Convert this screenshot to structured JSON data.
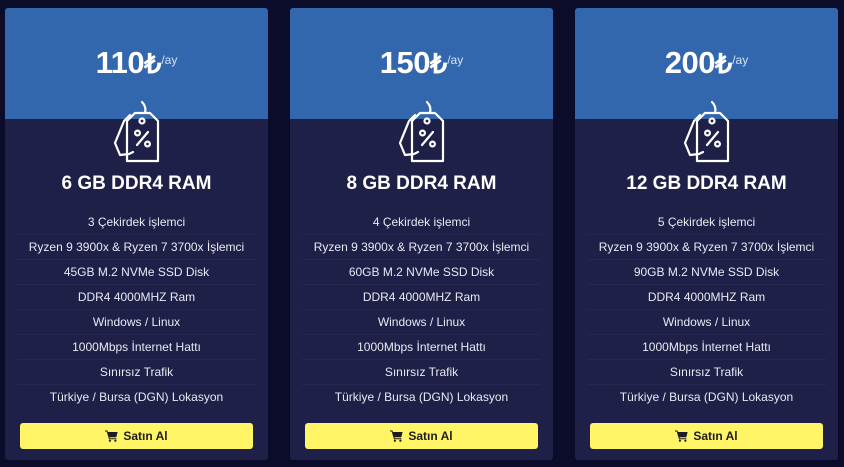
{
  "plans": [
    {
      "price": "110",
      "currency": "₺",
      "period": "/ay",
      "name": "6 GB DDR4 RAM",
      "features": [
        "3 Çekirdek işlemci",
        "Ryzen 9 3900x & Ryzen 7 3700x İşlemci",
        "45GB M.2 NVMe SSD Disk",
        "DDR4 4000MHZ Ram",
        "Windows / Linux",
        "1000Mbps İnternet Hattı",
        "Sınırsız Trafik",
        "Türkiye / Bursa (DGN) Lokasyon"
      ],
      "button_label": "Satın Al"
    },
    {
      "price": "150",
      "currency": "₺",
      "period": "/ay",
      "name": "8 GB DDR4 RAM",
      "features": [
        "4 Çekirdek işlemci",
        "Ryzen 9 3900x & Ryzen 7 3700x İşlemci",
        "60GB M.2 NVMe SSD Disk",
        "DDR4 4000MHZ Ram",
        "Windows / Linux",
        "1000Mbps İnternet Hattı",
        "Sınırsız Trafik",
        "Türkiye / Bursa (DGN) Lokasyon"
      ],
      "button_label": "Satın Al"
    },
    {
      "price": "200",
      "currency": "₺",
      "period": "/ay",
      "name": "12 GB DDR4 RAM",
      "features": [
        "5 Çekirdek işlemci",
        "Ryzen 9 3900x & Ryzen 7 3700x İşlemci",
        "90GB M.2 NVMe SSD Disk",
        "DDR4 4000MHZ Ram",
        "Windows / Linux",
        "1000Mbps İnternet Hattı",
        "Sınırsız Trafik",
        "Türkiye / Bursa (DGN) Lokasyon"
      ],
      "button_label": "Satın Al"
    }
  ],
  "icons": {
    "plan": "price-tag-percent-icon",
    "button": "shopping-cart-icon"
  },
  "colors": {
    "page_background": "#0b0c2a",
    "card_body": "#1f2047",
    "card_header": "#3267ad",
    "button": "#fff566",
    "button_text": "#1d1d1d"
  }
}
